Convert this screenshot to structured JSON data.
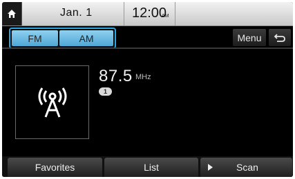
{
  "status_bar": {
    "date": "Jan.  1",
    "time": "12:00",
    "ampm": "AM",
    "home_icon": "home-icon"
  },
  "band": {
    "fm_label": "FM",
    "am_label": "AM",
    "selected": "FM"
  },
  "top_controls": {
    "menu_label": "Menu",
    "back_icon": "back-arrow-icon"
  },
  "station": {
    "frequency": "87.5",
    "unit": "MHz",
    "preset_number": "1",
    "artwork_icon": "radio-antenna-icon"
  },
  "bottom_bar": {
    "favorites_label": "Favorites",
    "list_label": "List",
    "scan_label": "Scan"
  },
  "colors": {
    "accent_highlight": "#29a7e0",
    "band_button": "#6ebde6"
  }
}
